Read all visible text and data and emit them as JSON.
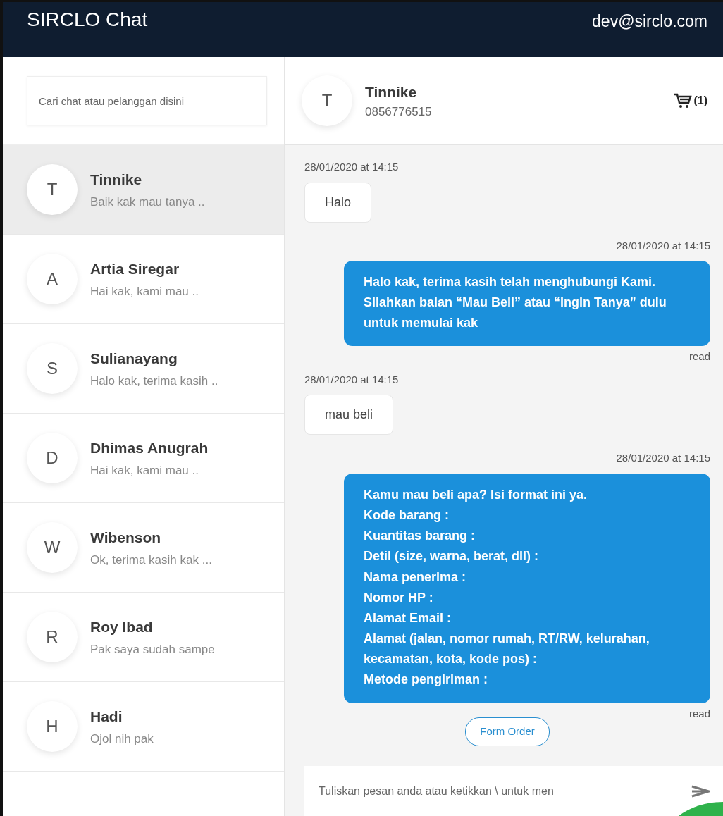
{
  "app": {
    "title": "SIRCLO Chat",
    "user": "dev@sirclo.com"
  },
  "search": {
    "placeholder": "Cari chat atau pelanggan disini"
  },
  "chats": [
    {
      "initial": "T",
      "name": "Tinnike",
      "preview": "Baik kak mau tanya ..",
      "selected": true
    },
    {
      "initial": "A",
      "name": "Artia Siregar",
      "preview": "Hai kak, kami mau ..",
      "selected": false
    },
    {
      "initial": "S",
      "name": "Sulianayang",
      "preview": "Halo kak, terima kasih ..",
      "selected": false
    },
    {
      "initial": "D",
      "name": "Dhimas Anugrah",
      "preview": "Hai kak, kami mau ..",
      "selected": false
    },
    {
      "initial": "W",
      "name": "Wibenson",
      "preview": "Ok, terima kasih kak ...",
      "selected": false
    },
    {
      "initial": "R",
      "name": "Roy Ibad",
      "preview": "Pak saya sudah sampe",
      "selected": false
    },
    {
      "initial": "H",
      "name": "Hadi",
      "preview": "Ojol nih pak",
      "selected": false
    }
  ],
  "contact": {
    "initial": "T",
    "name": "Tinnike",
    "phone": "0856776515",
    "cart_count": "(1)"
  },
  "messages": [
    {
      "kind": "incoming",
      "time": "28/01/2020 at 14:15",
      "text": "Halo"
    },
    {
      "kind": "outgoing",
      "time": "28/01/2020 at 14:15",
      "text": "Halo kak, terima kasih telah menghubungi Kami. Silahkan balan “Mau Beli” atau “Ingin Tanya” dulu untuk memulai kak",
      "status": "read"
    },
    {
      "kind": "incoming",
      "time": "28/01/2020 at 14:15",
      "text": "mau beli"
    },
    {
      "kind": "outgoing",
      "time": "28/01/2020 at 14:15",
      "text": "Kamu mau beli apa? Isi format ini ya.\nKode barang :\nKuantitas barang :\nDetil (size, warna, berat, dll) :\nNama penerima :\nNomor HP :\nAlamat Email :\nAlamat (jalan, nomor rumah, RT/RW, kelurahan, kecamatan, kota, kode pos) :\nMetode pengiriman :",
      "status": "read"
    }
  ],
  "form_button": "Form Order",
  "composer": {
    "placeholder": "Tuliskan pesan anda atau ketikkan \\ untuk men"
  }
}
